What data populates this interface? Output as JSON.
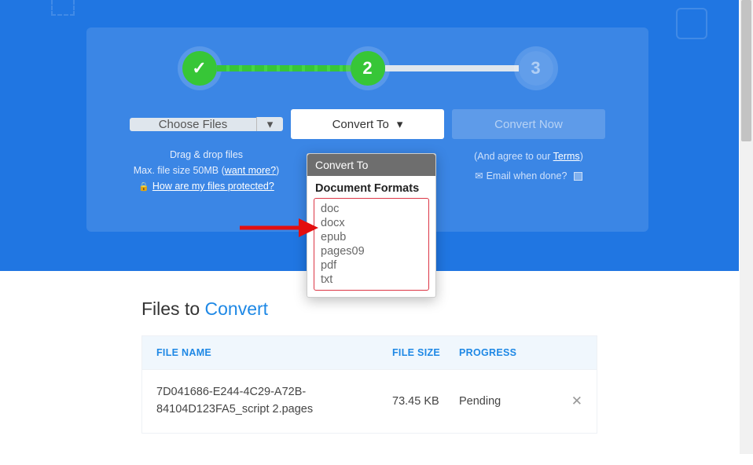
{
  "steps": {
    "s2": "2",
    "s3": "3"
  },
  "choose": {
    "label": "Choose Files",
    "hint_line1": "Drag & drop files",
    "hint_line2a": "Max. file size 50MB (",
    "hint_line2b": "want more?",
    "hint_line2c": ")",
    "protected": "How are my files protected?"
  },
  "convert": {
    "button": "Convert To",
    "dd_head": "Convert To",
    "dd_group": "Document Formats",
    "formats": [
      "doc",
      "docx",
      "epub",
      "pages09",
      "pdf",
      "txt"
    ]
  },
  "convert_now": {
    "label": "Convert Now",
    "agree_a": "(And agree to our ",
    "agree_b": "Terms",
    "agree_c": ")",
    "email": "Email when done?"
  },
  "files": {
    "title_a": "Files to ",
    "title_b": "Convert",
    "headers": {
      "name": "FILE NAME",
      "size": "FILE SIZE",
      "progress": "PROGRESS"
    },
    "rows": [
      {
        "name": "7D041686-E244-4C29-A72B-84104D123FA5_script 2.pages",
        "size": "73.45 KB",
        "progress": "Pending"
      }
    ]
  },
  "caret": "▾"
}
